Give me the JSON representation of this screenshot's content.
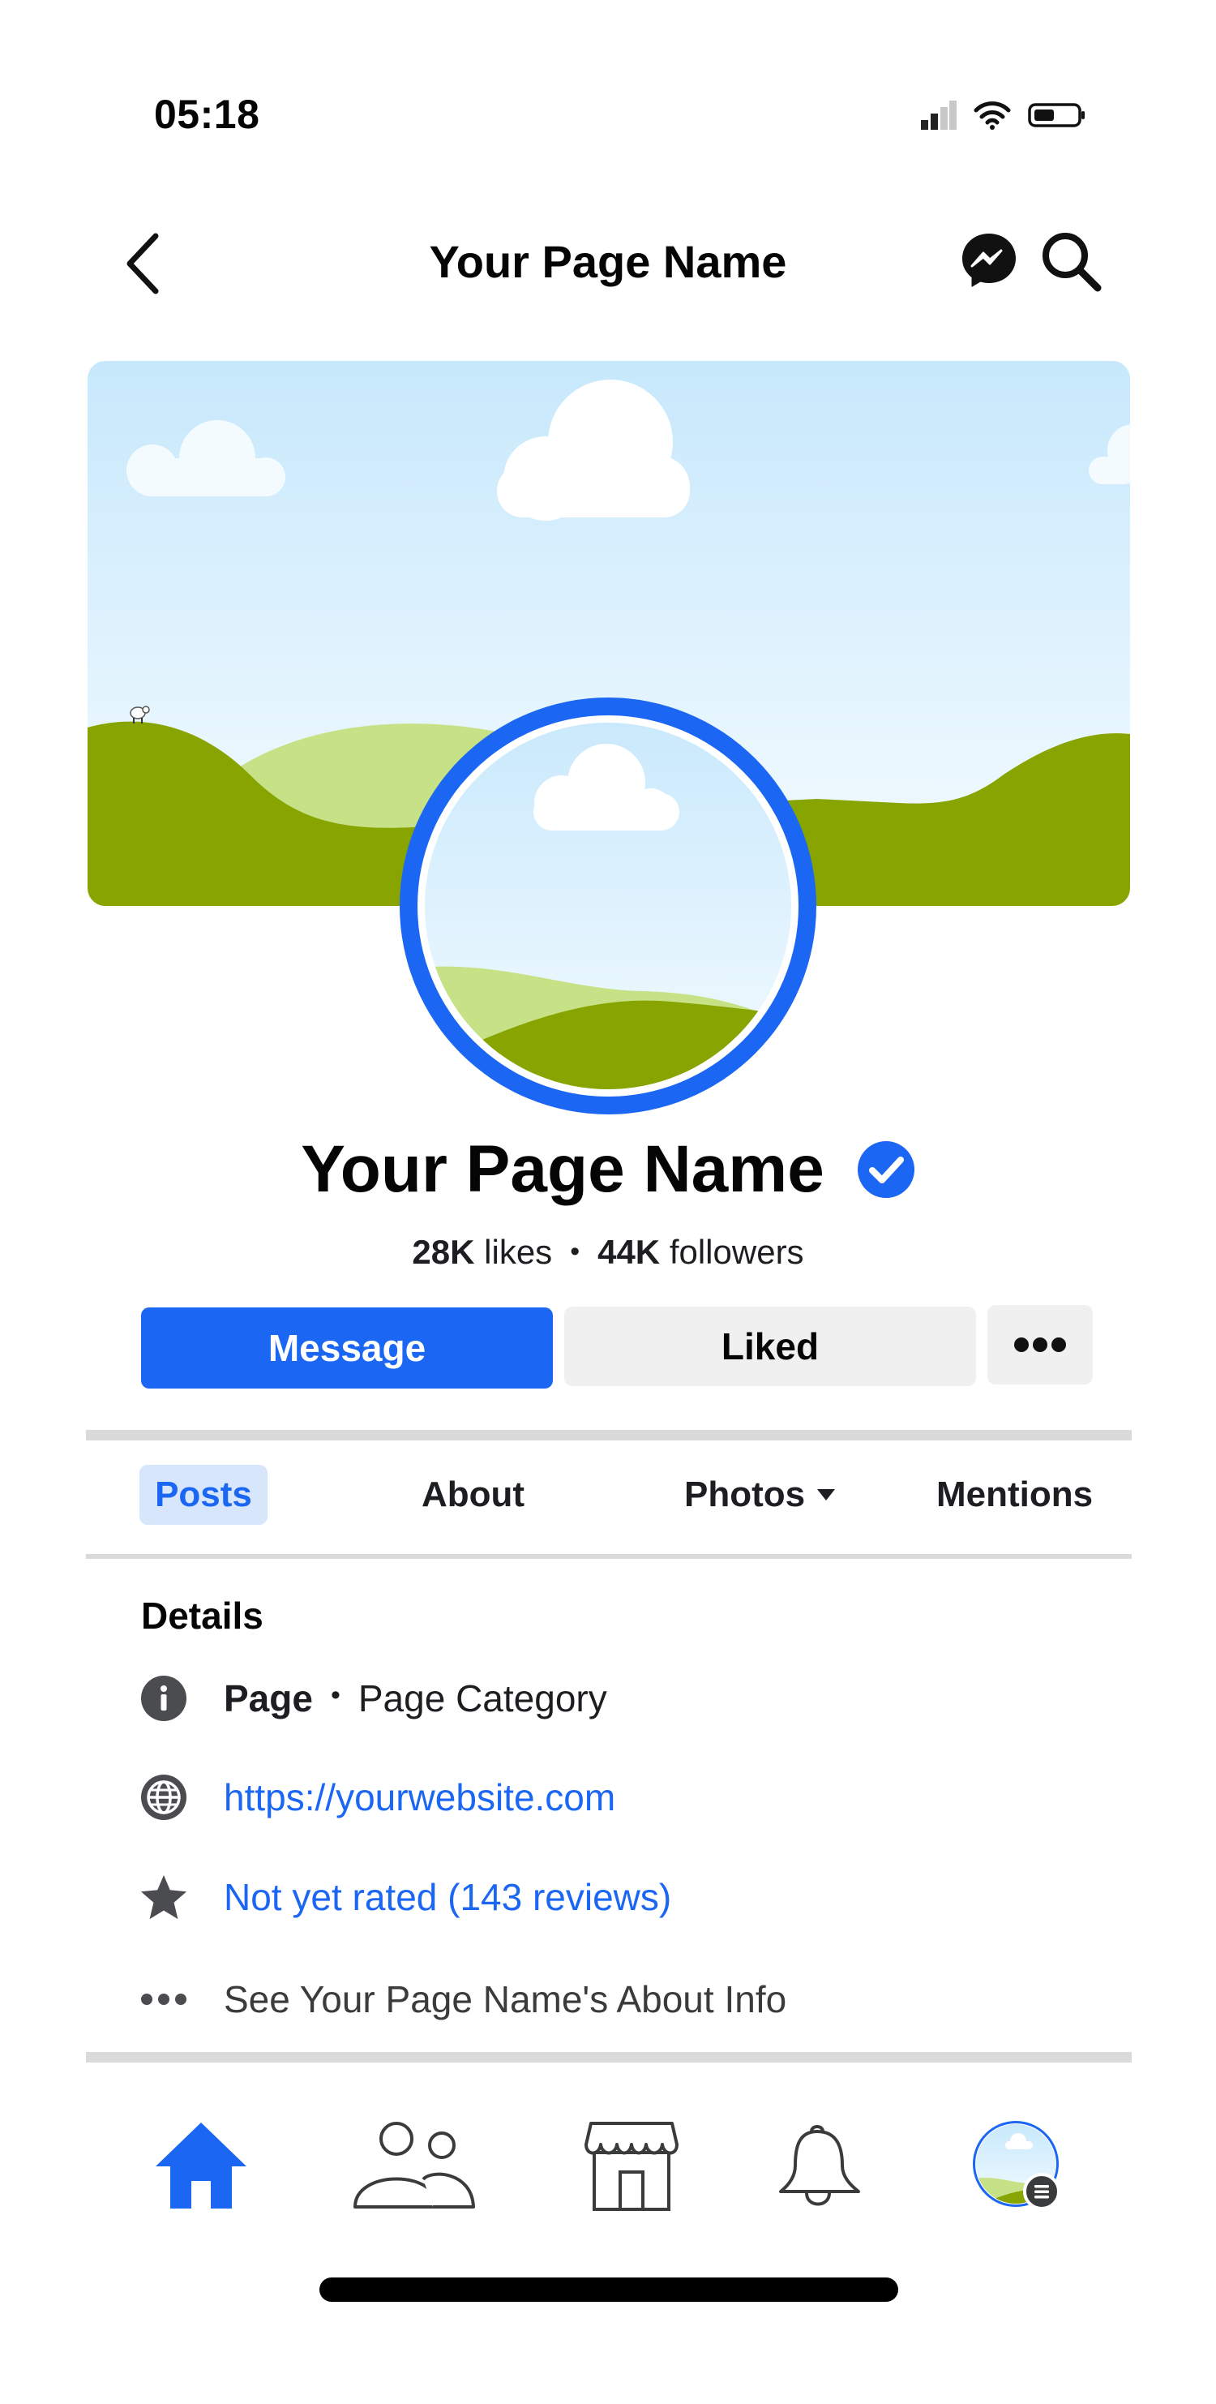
{
  "status_bar": {
    "time": "05:18"
  },
  "header": {
    "title": "Your Page Name"
  },
  "profile": {
    "name": "Your Page Name",
    "likes_count": "28K",
    "likes_label": "likes",
    "followers_count": "44K",
    "followers_label": "followers",
    "separator": "•"
  },
  "actions": {
    "message_label": "Message",
    "liked_label": "Liked"
  },
  "tabs": [
    {
      "label": "Posts",
      "active": true
    },
    {
      "label": "About"
    },
    {
      "label": "Photos"
    },
    {
      "label": "Mentions"
    }
  ],
  "details": {
    "title": "Details",
    "category_type": "Page",
    "category_separator": "•",
    "category": "Page Category",
    "website": "https://yourwebsite.com",
    "rating": "Not yet rated (143 reviews)",
    "about_link": "See Your Page Name's About Info"
  },
  "icons": {
    "back": "chevron-left-icon",
    "messenger": "messenger-icon",
    "search": "search-icon",
    "verified": "verified-badge-icon",
    "more": "more-dots-icon",
    "info": "info-icon",
    "globe": "globe-icon",
    "star": "star-icon",
    "home": "home-icon",
    "friends": "friends-icon",
    "marketplace": "marketplace-icon",
    "notifications": "bell-icon",
    "menu": "menu-icon"
  },
  "colors": {
    "accent": "#1b66f3",
    "tab_active_bg": "#d7e6fb",
    "sky_top": "#c7e8fc",
    "grass_dark": "#87a400",
    "grass_light": "#c6e186"
  }
}
